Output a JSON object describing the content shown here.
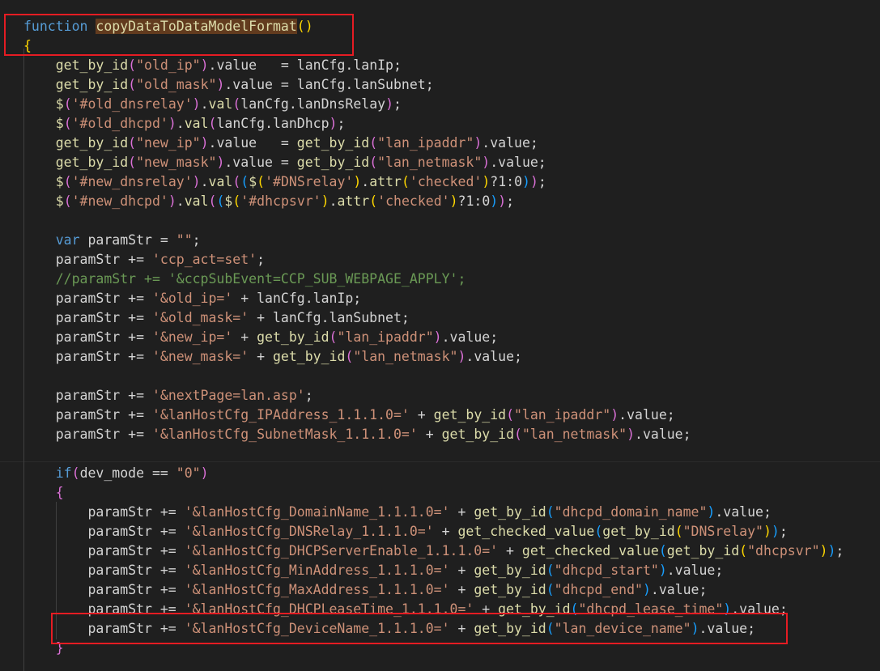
{
  "colors": {
    "background": "#1f1f1f",
    "default": "#d4d4d4",
    "keyword": "#569cd6",
    "function": "#dcdcaa",
    "string": "#ce9178",
    "comment": "#6a9955",
    "variable": "#9cdcfe",
    "bracket_yellow": "#ffd700",
    "bracket_purple": "#da70d6",
    "bracket_blue": "#179fff",
    "number": "#b5cea8",
    "highlight_box": "#e51c23"
  },
  "code": {
    "language": "javascript",
    "lines": [
      [
        [
          "k",
          "function"
        ],
        [
          "t",
          " "
        ],
        [
          "fs",
          "copyDataToDataModelFormat"
        ],
        [
          "b1",
          "()"
        ]
      ],
      [
        [
          "b1",
          "{"
        ]
      ],
      [
        [
          "t",
          "    "
        ],
        [
          "f",
          "get_by_id"
        ],
        [
          "b2",
          "("
        ],
        [
          "s",
          "\"old_ip\""
        ],
        [
          "b2",
          ")"
        ],
        [
          "t",
          ".value   = lanCfg.lanIp;"
        ]
      ],
      [
        [
          "t",
          "    "
        ],
        [
          "f",
          "get_by_id"
        ],
        [
          "b2",
          "("
        ],
        [
          "s",
          "\"old_mask\""
        ],
        [
          "b2",
          ")"
        ],
        [
          "t",
          ".value = lanCfg.lanSubnet;"
        ]
      ],
      [
        [
          "t",
          "    "
        ],
        [
          "f",
          "$"
        ],
        [
          "b2",
          "("
        ],
        [
          "s",
          "'#old_dnsrelay'"
        ],
        [
          "b2",
          ")"
        ],
        [
          "t",
          "."
        ],
        [
          "f",
          "val"
        ],
        [
          "b2",
          "("
        ],
        [
          "t",
          "lanCfg.lanDnsRelay"
        ],
        [
          "b2",
          ")"
        ],
        [
          "t",
          ";"
        ]
      ],
      [
        [
          "t",
          "    "
        ],
        [
          "f",
          "$"
        ],
        [
          "b2",
          "("
        ],
        [
          "s",
          "'#old_dhcpd'"
        ],
        [
          "b2",
          ")"
        ],
        [
          "t",
          "."
        ],
        [
          "f",
          "val"
        ],
        [
          "b2",
          "("
        ],
        [
          "t",
          "lanCfg.lanDhcp"
        ],
        [
          "b2",
          ")"
        ],
        [
          "t",
          ";"
        ]
      ],
      [
        [
          "t",
          "    "
        ],
        [
          "f",
          "get_by_id"
        ],
        [
          "b2",
          "("
        ],
        [
          "s",
          "\"new_ip\""
        ],
        [
          "b2",
          ")"
        ],
        [
          "t",
          ".value   = "
        ],
        [
          "f",
          "get_by_id"
        ],
        [
          "b2",
          "("
        ],
        [
          "s",
          "\"lan_ipaddr\""
        ],
        [
          "b2",
          ")"
        ],
        [
          "t",
          ".value;"
        ]
      ],
      [
        [
          "t",
          "    "
        ],
        [
          "f",
          "get_by_id"
        ],
        [
          "b2",
          "("
        ],
        [
          "s",
          "\"new_mask\""
        ],
        [
          "b2",
          ")"
        ],
        [
          "t",
          ".value = "
        ],
        [
          "f",
          "get_by_id"
        ],
        [
          "b2",
          "("
        ],
        [
          "s",
          "\"lan_netmask\""
        ],
        [
          "b2",
          ")"
        ],
        [
          "t",
          ".value;"
        ]
      ],
      [
        [
          "t",
          "    "
        ],
        [
          "f",
          "$"
        ],
        [
          "b2",
          "("
        ],
        [
          "s",
          "'#new_dnsrelay'"
        ],
        [
          "b2",
          ")"
        ],
        [
          "t",
          "."
        ],
        [
          "f",
          "val"
        ],
        [
          "b2",
          "("
        ],
        [
          "b3",
          "("
        ],
        [
          "f",
          "$"
        ],
        [
          "b1",
          "("
        ],
        [
          "s",
          "'#DNSrelay'"
        ],
        [
          "b1",
          ")"
        ],
        [
          "t",
          "."
        ],
        [
          "f",
          "attr"
        ],
        [
          "b1",
          "("
        ],
        [
          "s",
          "'checked'"
        ],
        [
          "b1",
          ")"
        ],
        [
          "t",
          "?1:0"
        ],
        [
          "b3",
          ")"
        ],
        [
          "b2",
          ")"
        ],
        [
          "t",
          ";"
        ]
      ],
      [
        [
          "t",
          "    "
        ],
        [
          "f",
          "$"
        ],
        [
          "b2",
          "("
        ],
        [
          "s",
          "'#new_dhcpd'"
        ],
        [
          "b2",
          ")"
        ],
        [
          "t",
          "."
        ],
        [
          "f",
          "val"
        ],
        [
          "b2",
          "("
        ],
        [
          "b3",
          "("
        ],
        [
          "f",
          "$"
        ],
        [
          "b1",
          "("
        ],
        [
          "s",
          "'#dhcpsvr'"
        ],
        [
          "b1",
          ")"
        ],
        [
          "t",
          "."
        ],
        [
          "f",
          "attr"
        ],
        [
          "b1",
          "("
        ],
        [
          "s",
          "'checked'"
        ],
        [
          "b1",
          ")"
        ],
        [
          "t",
          "?1:0"
        ],
        [
          "b3",
          ")"
        ],
        [
          "b2",
          ")"
        ],
        [
          "t",
          ";"
        ]
      ],
      [],
      [
        [
          "t",
          "    "
        ],
        [
          "k",
          "var"
        ],
        [
          "t",
          " paramStr = "
        ],
        [
          "s",
          "\"\""
        ],
        [
          "t",
          ";"
        ]
      ],
      [
        [
          "t",
          "    paramStr += "
        ],
        [
          "s",
          "'ccp_act=set'"
        ],
        [
          "t",
          ";"
        ]
      ],
      [
        [
          "t",
          "    "
        ],
        [
          "c",
          "//paramStr += '&ccpSubEvent=CCP_SUB_WEBPAGE_APPLY';"
        ]
      ],
      [
        [
          "t",
          "    paramStr += "
        ],
        [
          "s",
          "'&old_ip='"
        ],
        [
          "t",
          " + lanCfg.lanIp;"
        ]
      ],
      [
        [
          "t",
          "    paramStr += "
        ],
        [
          "s",
          "'&old_mask='"
        ],
        [
          "t",
          " + lanCfg.lanSubnet;"
        ]
      ],
      [
        [
          "t",
          "    paramStr += "
        ],
        [
          "s",
          "'&new_ip='"
        ],
        [
          "t",
          " + "
        ],
        [
          "f",
          "get_by_id"
        ],
        [
          "b2",
          "("
        ],
        [
          "s",
          "\"lan_ipaddr\""
        ],
        [
          "b2",
          ")"
        ],
        [
          "t",
          ".value;"
        ]
      ],
      [
        [
          "t",
          "    paramStr += "
        ],
        [
          "s",
          "'&new_mask='"
        ],
        [
          "t",
          " + "
        ],
        [
          "f",
          "get_by_id"
        ],
        [
          "b2",
          "("
        ],
        [
          "s",
          "\"lan_netmask\""
        ],
        [
          "b2",
          ")"
        ],
        [
          "t",
          ".value;"
        ]
      ],
      [],
      [
        [
          "t",
          "    paramStr += "
        ],
        [
          "s",
          "'&nextPage=lan.asp'"
        ],
        [
          "t",
          ";"
        ]
      ],
      [
        [
          "t",
          "    paramStr += "
        ],
        [
          "s",
          "'&lanHostCfg_IPAddress_1.1.1.0='"
        ],
        [
          "t",
          " + "
        ],
        [
          "f",
          "get_by_id"
        ],
        [
          "b2",
          "("
        ],
        [
          "s",
          "\"lan_ipaddr\""
        ],
        [
          "b2",
          ")"
        ],
        [
          "t",
          ".value;"
        ]
      ],
      [
        [
          "t",
          "    paramStr += "
        ],
        [
          "s",
          "'&lanHostCfg_SubnetMask_1.1.1.0='"
        ],
        [
          "t",
          " + "
        ],
        [
          "f",
          "get_by_id"
        ],
        [
          "b2",
          "("
        ],
        [
          "s",
          "\"lan_netmask\""
        ],
        [
          "b2",
          ")"
        ],
        [
          "t",
          ".value;"
        ]
      ],
      [],
      [
        [
          "t",
          "    "
        ],
        [
          "k",
          "if"
        ],
        [
          "b2",
          "("
        ],
        [
          "t",
          "dev_mode == "
        ],
        [
          "s",
          "\"0\""
        ],
        [
          "b2",
          ")"
        ]
      ],
      [
        [
          "t",
          "    "
        ],
        [
          "b2",
          "{"
        ]
      ],
      [
        [
          "t",
          "        paramStr += "
        ],
        [
          "s",
          "'&lanHostCfg_DomainName_1.1.1.0='"
        ],
        [
          "t",
          " + "
        ],
        [
          "f",
          "get_by_id"
        ],
        [
          "b3",
          "("
        ],
        [
          "s",
          "\"dhcpd_domain_name\""
        ],
        [
          "b3",
          ")"
        ],
        [
          "t",
          ".value;"
        ]
      ],
      [
        [
          "t",
          "        paramStr += "
        ],
        [
          "s",
          "'&lanHostCfg_DNSRelay_1.1.1.0='"
        ],
        [
          "t",
          " + "
        ],
        [
          "f",
          "get_checked_value"
        ],
        [
          "b3",
          "("
        ],
        [
          "f",
          "get_by_id"
        ],
        [
          "b1",
          "("
        ],
        [
          "s",
          "\"DNSrelay\""
        ],
        [
          "b1",
          ")"
        ],
        [
          "b3",
          ")"
        ],
        [
          "t",
          ";"
        ]
      ],
      [
        [
          "t",
          "        paramStr += "
        ],
        [
          "s",
          "'&lanHostCfg_DHCPServerEnable_1.1.1.0='"
        ],
        [
          "t",
          " + "
        ],
        [
          "f",
          "get_checked_value"
        ],
        [
          "b3",
          "("
        ],
        [
          "f",
          "get_by_id"
        ],
        [
          "b1",
          "("
        ],
        [
          "s",
          "\"dhcpsvr\""
        ],
        [
          "b1",
          ")"
        ],
        [
          "b3",
          ")"
        ],
        [
          "t",
          ";"
        ]
      ],
      [
        [
          "t",
          "        paramStr += "
        ],
        [
          "s",
          "'&lanHostCfg_MinAddress_1.1.1.0='"
        ],
        [
          "t",
          " + "
        ],
        [
          "f",
          "get_by_id"
        ],
        [
          "b3",
          "("
        ],
        [
          "s",
          "\"dhcpd_start\""
        ],
        [
          "b3",
          ")"
        ],
        [
          "t",
          ".value;"
        ]
      ],
      [
        [
          "t",
          "        paramStr += "
        ],
        [
          "s",
          "'&lanHostCfg_MaxAddress_1.1.1.0='"
        ],
        [
          "t",
          " + "
        ],
        [
          "f",
          "get_by_id"
        ],
        [
          "b3",
          "("
        ],
        [
          "s",
          "\"dhcpd_end\""
        ],
        [
          "b3",
          ")"
        ],
        [
          "t",
          ".value;"
        ]
      ],
      [
        [
          "t",
          "        paramStr += "
        ],
        [
          "s",
          "'&lanHostCfg_DHCPLeaseTime_1.1.1.0='"
        ],
        [
          "t",
          " + "
        ],
        [
          "f",
          "get_by_id"
        ],
        [
          "b3",
          "("
        ],
        [
          "s",
          "\"dhcpd_lease_time\""
        ],
        [
          "b3",
          ")"
        ],
        [
          "t",
          ".value;"
        ]
      ],
      [
        [
          "t",
          "        paramStr += "
        ],
        [
          "s",
          "'&lanHostCfg_DeviceName_1.1.1.0='"
        ],
        [
          "t",
          " + "
        ],
        [
          "f",
          "get_by_id"
        ],
        [
          "b3",
          "("
        ],
        [
          "s",
          "\"lan_device_name\""
        ],
        [
          "b3",
          ")"
        ],
        [
          "t",
          ".value;"
        ]
      ],
      [
        [
          "t",
          "    "
        ],
        [
          "b2",
          "}"
        ]
      ]
    ]
  }
}
